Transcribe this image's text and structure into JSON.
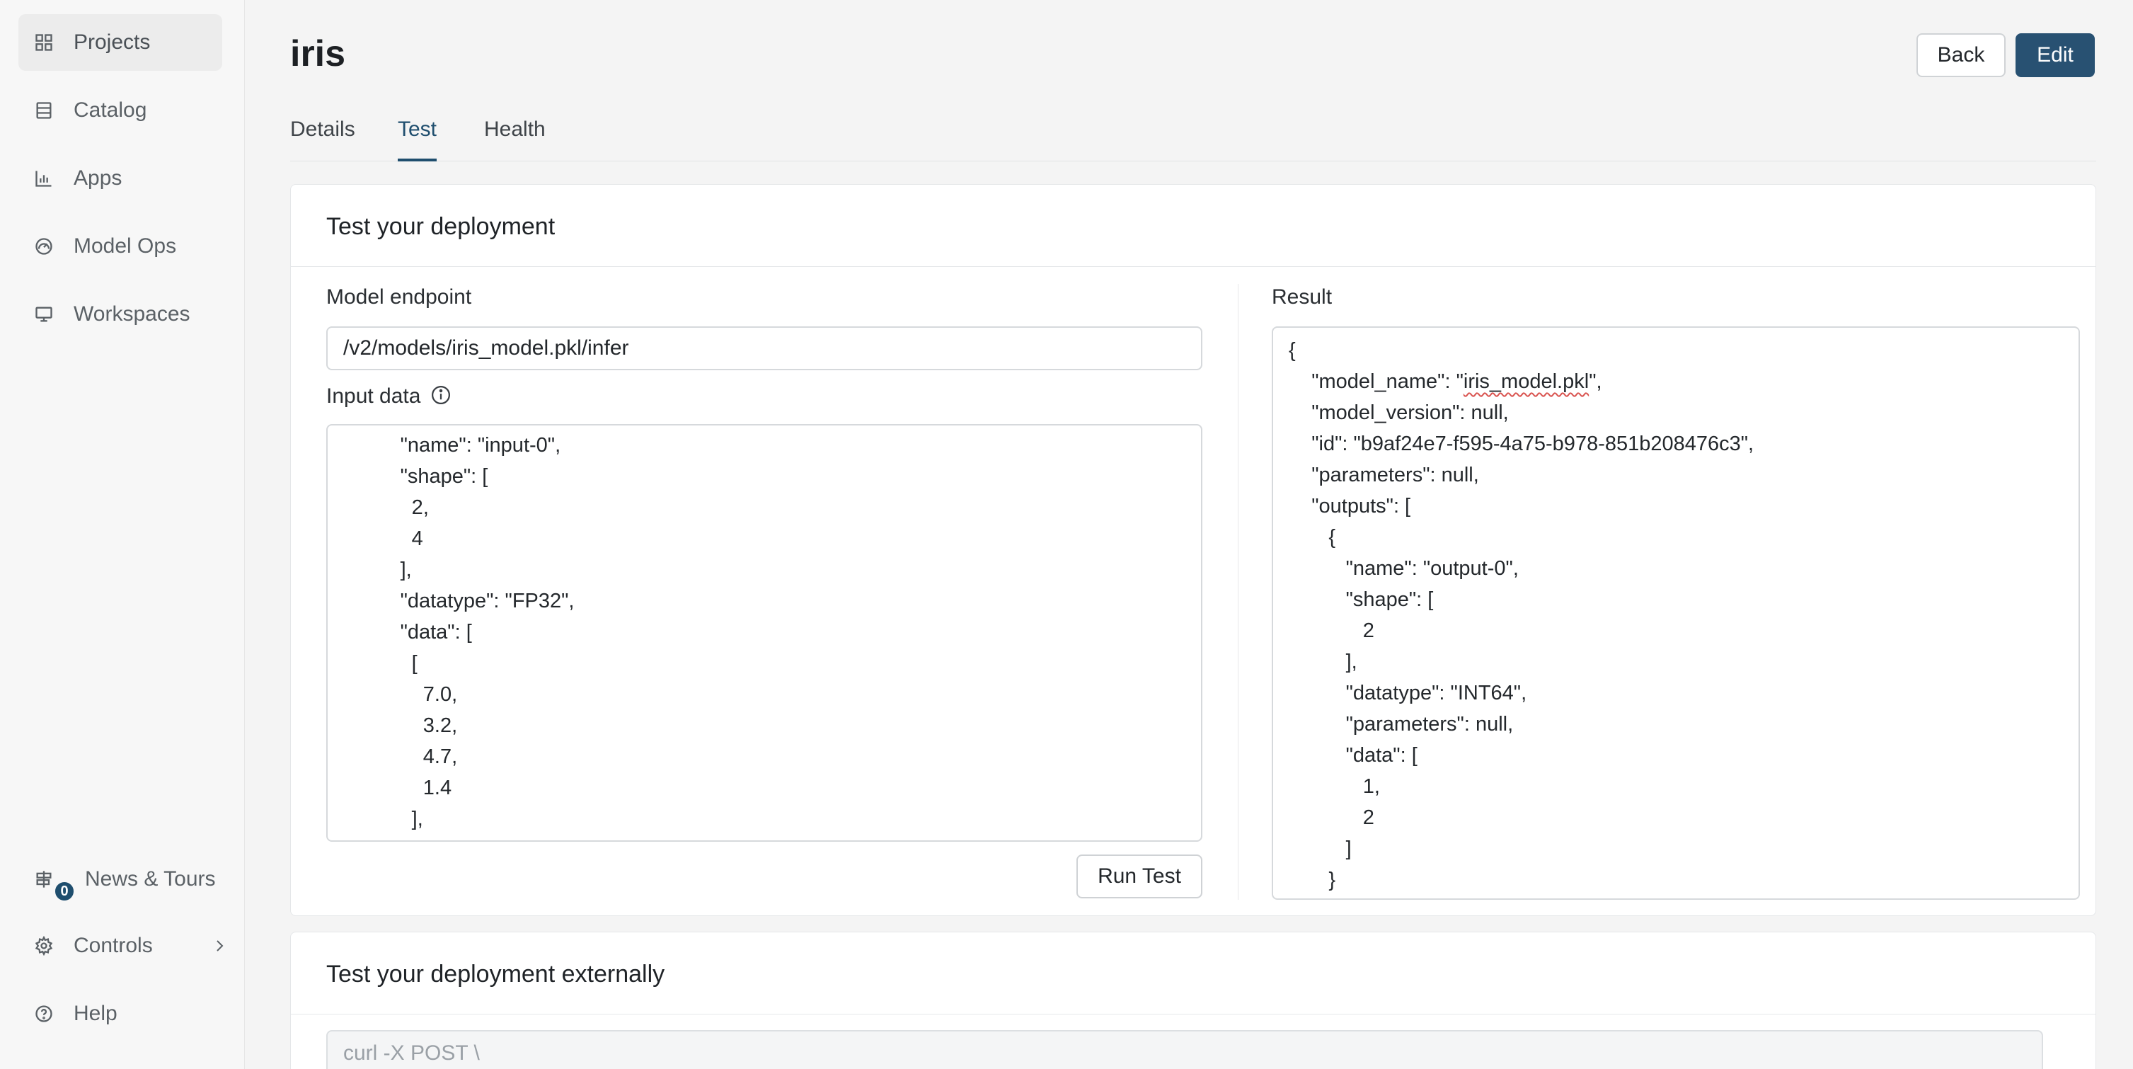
{
  "sidebar": {
    "items": [
      {
        "label": "Projects",
        "icon": "grid-icon"
      },
      {
        "label": "Catalog",
        "icon": "catalog-icon"
      },
      {
        "label": "Apps",
        "icon": "bar-chart-icon"
      },
      {
        "label": "Model Ops",
        "icon": "gauge-icon"
      },
      {
        "label": "Workspaces",
        "icon": "monitor-icon"
      }
    ],
    "bottom": {
      "news": {
        "label": "News & Tours",
        "badge": "0"
      },
      "controls": {
        "label": "Controls"
      },
      "help": {
        "label": "Help"
      }
    }
  },
  "header": {
    "title": "iris",
    "back_label": "Back",
    "edit_label": "Edit"
  },
  "tabs": [
    "Details",
    "Test",
    "Health"
  ],
  "active_tab": "Test",
  "test_card": {
    "title": "Test your deployment",
    "endpoint_label": "Model endpoint",
    "endpoint_value": "/v2/models/iris_model.pkl/infer",
    "input_label": "Input data",
    "input_code": "          \"name\": \"input-0\",\n          \"shape\": [\n            2,\n            4\n          ],\n          \"datatype\": \"FP32\",\n          \"data\": [\n            [\n              7.0,\n              3.2,\n              4.7,\n              1.4\n            ],\n            [",
    "run_label": "Run Test",
    "result_label": "Result",
    "result_lines": {
      "l1": "{",
      "l2_pre": "    \"model_name\": \"",
      "l2_word": "iris_model.pkl",
      "l2_post": "\",",
      "rest": "    \"model_version\": null,\n    \"id\": \"b9af24e7-f595-4a75-b978-851b208476c3\",\n    \"parameters\": null,\n    \"outputs\": [\n       {\n          \"name\": \"output-0\",\n          \"shape\": [\n             2\n          ],\n          \"datatype\": \"INT64\",\n          \"parameters\": null,\n          \"data\": [\n             1,\n             2\n          ]\n       }"
    }
  },
  "external_card": {
    "title": "Test your deployment externally",
    "curl_text": "curl -X POST \\"
  },
  "colors": {
    "accent": "#1f4e6e",
    "edit_button": "#285172"
  }
}
